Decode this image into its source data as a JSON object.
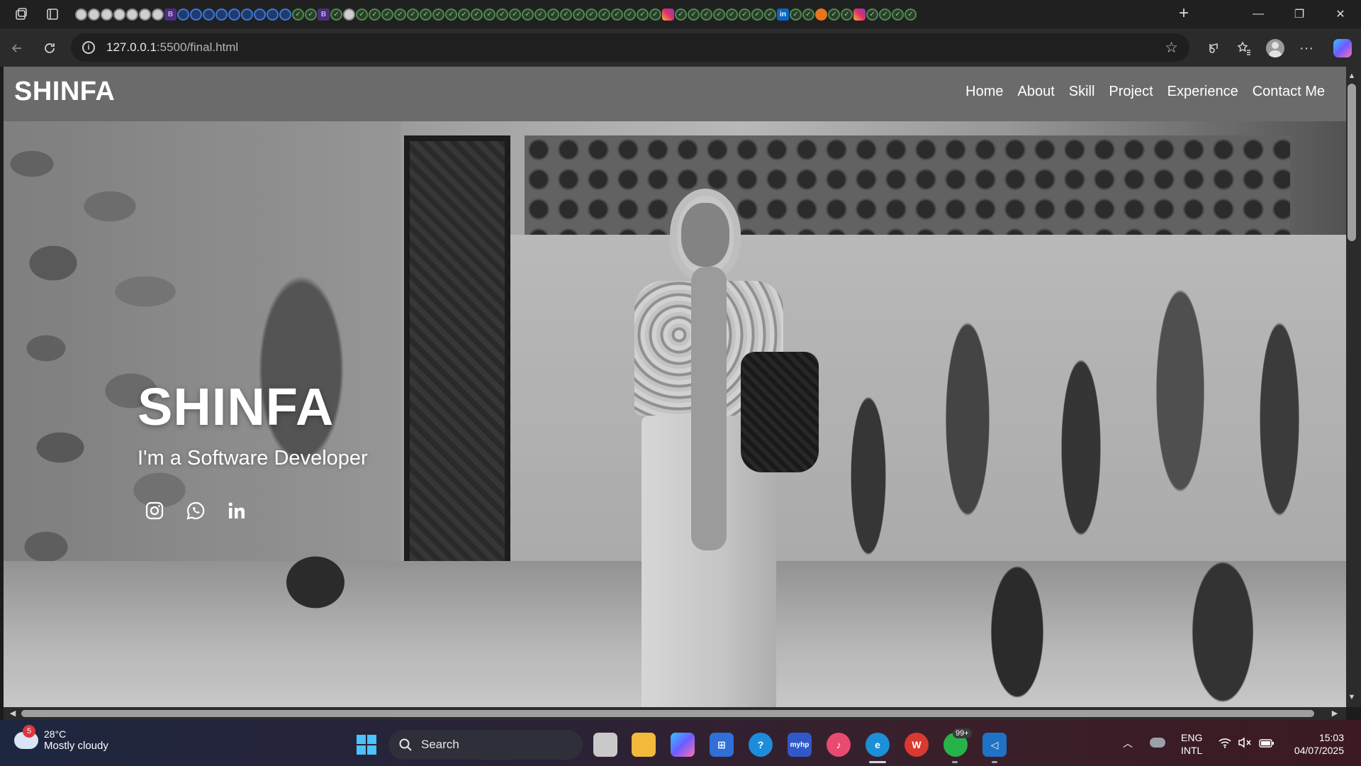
{
  "browser": {
    "url_host": "127.0.0.1",
    "url_rest": ":5500/final.html",
    "new_tab_label": "+",
    "window_controls": {
      "minimize": "—",
      "restore": "❐",
      "close": "✕"
    }
  },
  "site": {
    "logo": "SHINFA",
    "nav": [
      "Home",
      "About",
      "Skill",
      "Project",
      "Experience",
      "Contact Me"
    ],
    "hero_title": "SHINFA",
    "hero_subtitle": "I'm a Software Developer",
    "socials": [
      "instagram-icon",
      "whatsapp-icon",
      "linkedin-icon"
    ]
  },
  "taskbar": {
    "weather_badge": "5",
    "temperature": "28°C",
    "condition": "Mostly cloudy",
    "search_label": "Search",
    "whatsapp_badge": "99+",
    "lang_line1": "ENG",
    "lang_line2": "INTL",
    "time": "15:03",
    "date": "04/07/2025"
  },
  "colors": {
    "header_bg": "#6b6b6b",
    "start_blue": "#4cc2ff",
    "chrome_bg": "#202020"
  }
}
